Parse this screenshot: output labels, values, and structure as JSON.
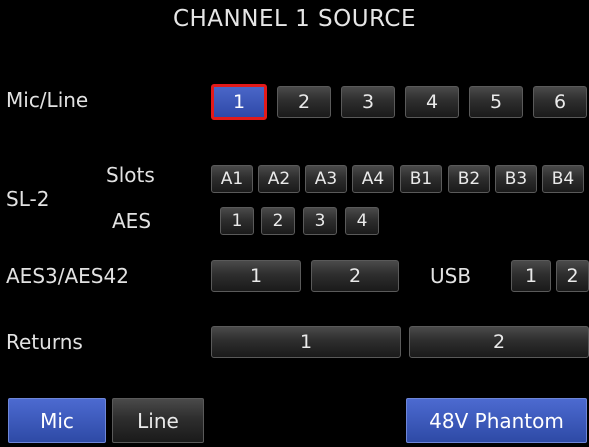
{
  "title": "CHANNEL 1 SOURCE",
  "rows": {
    "mic_line": {
      "label": "Mic/Line",
      "buttons": [
        "1",
        "2",
        "3",
        "4",
        "5",
        "6"
      ],
      "selected": "1"
    },
    "sl2": {
      "label": "SL-2",
      "slots": {
        "label": "Slots",
        "buttons": [
          "A1",
          "A2",
          "A3",
          "A4",
          "B1",
          "B2",
          "B3",
          "B4"
        ]
      },
      "aes": {
        "label": "AES",
        "buttons": [
          "1",
          "2",
          "3",
          "4"
        ]
      }
    },
    "aes3": {
      "label": "AES3/AES42",
      "buttons": [
        "1",
        "2"
      ]
    },
    "usb": {
      "label": "USB",
      "buttons": [
        "1",
        "2"
      ]
    },
    "returns": {
      "label": "Returns",
      "buttons": [
        "1",
        "2"
      ]
    }
  },
  "bottom": {
    "mic": "Mic",
    "line": "Line",
    "phantom": "48V Phantom"
  },
  "colors": {
    "selected_fill": "#3a56b8",
    "selected_border": "#e21a1a",
    "blue_button": "#3d5ac0"
  }
}
